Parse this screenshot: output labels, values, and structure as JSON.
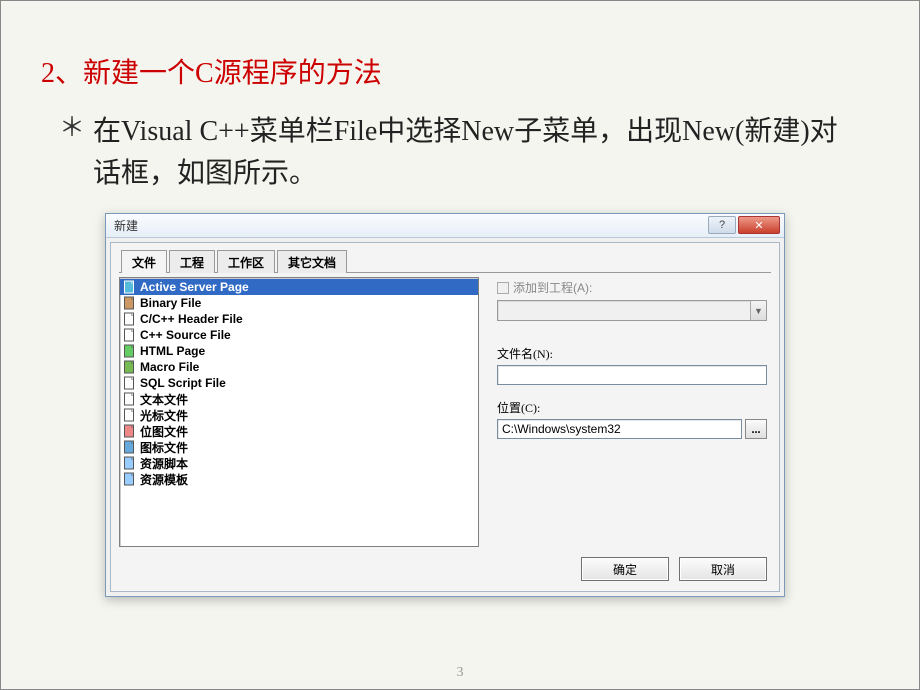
{
  "slide": {
    "heading_num": "2、",
    "heading_text": "新建一个C源程序的方法",
    "bullet": "＊",
    "body": "在Visual C++菜单栏File中选择New子菜单，出现New(新建)对话框，如图所示。",
    "page_number": "3"
  },
  "dialog": {
    "title": "新建",
    "help_icon": "?",
    "close_icon": "✕",
    "tabs": [
      "文件",
      "工程",
      "工作区",
      "其它文档"
    ],
    "active_tab": 0,
    "file_types": [
      {
        "label": "Active Server Page",
        "selected": true,
        "icon": "asp"
      },
      {
        "label": "Binary File",
        "selected": false,
        "icon": "bin"
      },
      {
        "label": "C/C++ Header File",
        "selected": false,
        "icon": "h"
      },
      {
        "label": "C++ Source File",
        "selected": false,
        "icon": "cpp"
      },
      {
        "label": "HTML Page",
        "selected": false,
        "icon": "html"
      },
      {
        "label": "Macro File",
        "selected": false,
        "icon": "macro"
      },
      {
        "label": "SQL Script File",
        "selected": false,
        "icon": "sql"
      },
      {
        "label": "文本文件",
        "selected": false,
        "icon": "txt"
      },
      {
        "label": "光标文件",
        "selected": false,
        "icon": "cur"
      },
      {
        "label": "位图文件",
        "selected": false,
        "icon": "bmp"
      },
      {
        "label": "图标文件",
        "selected": false,
        "icon": "ico"
      },
      {
        "label": "资源脚本",
        "selected": false,
        "icon": "rc"
      },
      {
        "label": "资源模板",
        "selected": false,
        "icon": "rct"
      }
    ],
    "add_to_project_label": "添加到工程(A):",
    "filename_label": "文件名(N):",
    "filename_value": "",
    "location_label": "位置(C):",
    "location_value": "C:\\Windows\\system32",
    "browse_label": "...",
    "ok_label": "确定",
    "cancel_label": "取消"
  }
}
